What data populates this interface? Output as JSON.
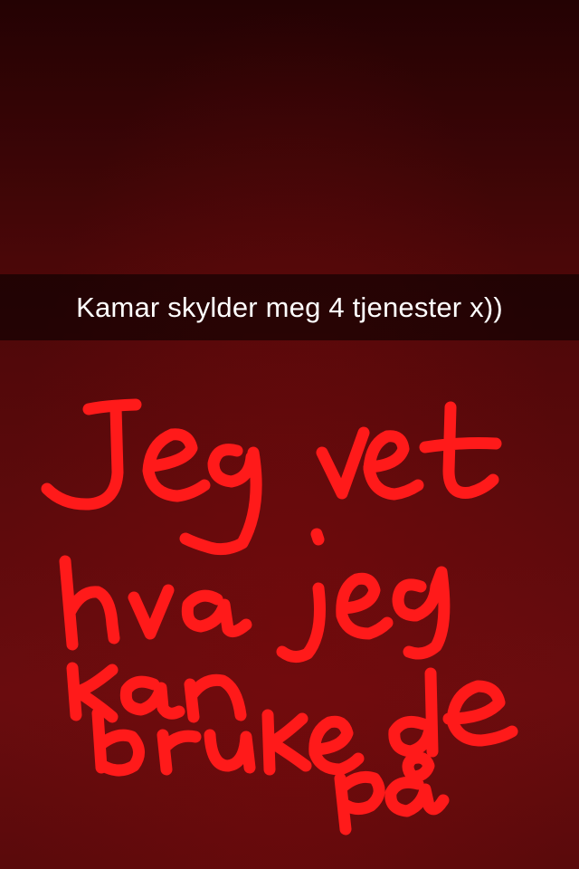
{
  "snap": {
    "caption": "Kamar skylder meg 4 tjenester x))",
    "drawing_text": "Jeg vet hva jeg kan bruke de på",
    "drawing_color": "#ff1a1a",
    "background_color": "#5a0a0b"
  }
}
